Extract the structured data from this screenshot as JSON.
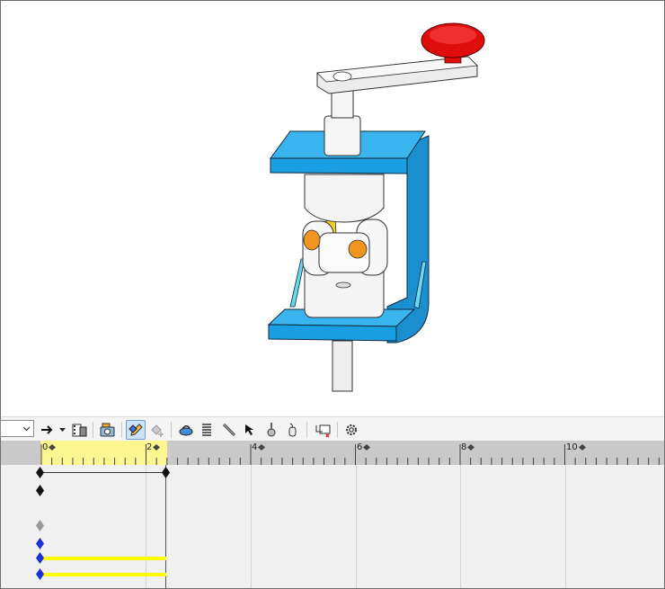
{
  "viewport": {
    "scene": "assembly-model",
    "colors": {
      "bracket": "#1ea4e8",
      "knob": "#e00d0d",
      "joint_pin": "#f0961e",
      "body": "#f2f2f2",
      "accent_yellow": "#f0d21e"
    }
  },
  "toolbar": {
    "combo_value": "",
    "icons": [
      "arrow-right-icon",
      "dropdown-icon",
      "film-calc-icon",
      "camera-icon",
      "keyframe-edit-icon",
      "key-add-icon",
      "motor-icon",
      "spring-icon",
      "contact-icon",
      "pointer-icon",
      "gravity-icon",
      "damper-icon",
      "results-icon",
      "settings-icon"
    ]
  },
  "timeline": {
    "ruler_labels": [
      "0",
      "2",
      "4",
      "6",
      "8",
      "10"
    ],
    "highlight_color": "#fcf691",
    "track_bar_color": "#ffff00"
  }
}
